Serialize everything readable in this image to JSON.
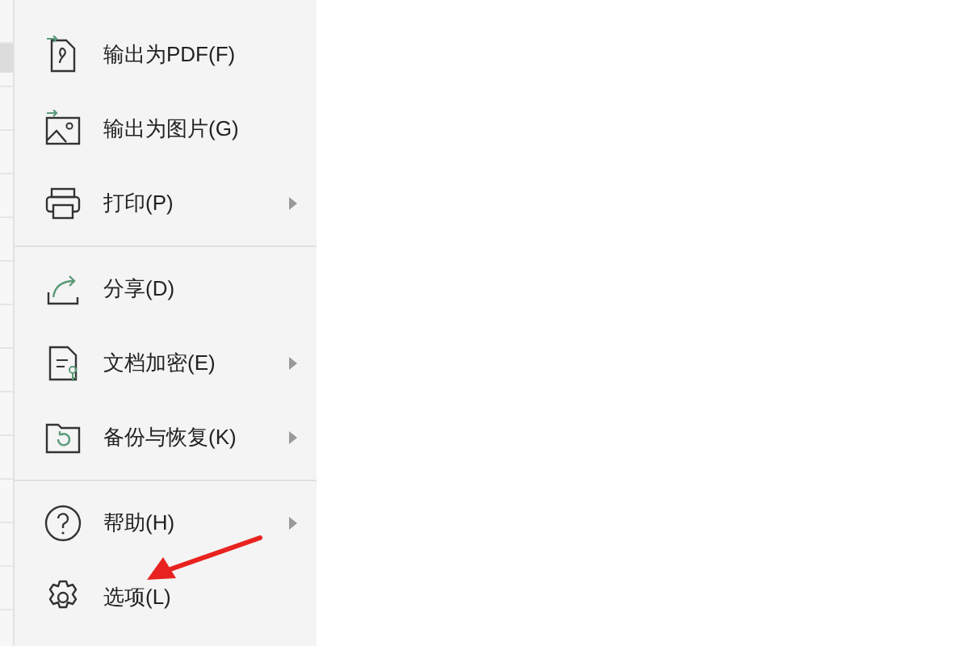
{
  "menu": {
    "groups": [
      {
        "items": [
          {
            "label": "输出为PDF(F)",
            "has_submenu": false
          },
          {
            "label": "输出为图片(G)",
            "has_submenu": false
          },
          {
            "label": "打印(P)",
            "has_submenu": true
          }
        ]
      },
      {
        "items": [
          {
            "label": "分享(D)",
            "has_submenu": false
          },
          {
            "label": "文档加密(E)",
            "has_submenu": true
          },
          {
            "label": "备份与恢复(K)",
            "has_submenu": true
          }
        ]
      },
      {
        "items": [
          {
            "label": "帮助(H)",
            "has_submenu": true
          },
          {
            "label": "选项(L)",
            "has_submenu": false
          }
        ]
      }
    ]
  }
}
